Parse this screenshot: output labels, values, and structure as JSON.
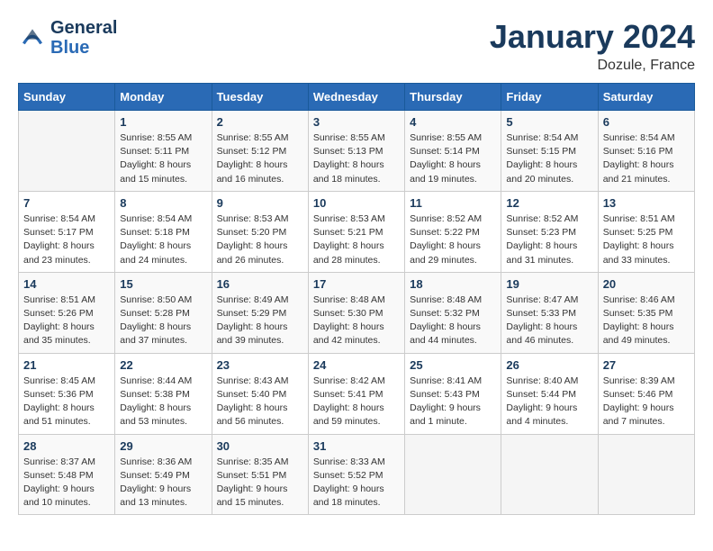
{
  "header": {
    "logo_line1": "General",
    "logo_line2": "Blue",
    "title": "January 2024",
    "subtitle": "Dozule, France"
  },
  "columns": [
    "Sunday",
    "Monday",
    "Tuesday",
    "Wednesday",
    "Thursday",
    "Friday",
    "Saturday"
  ],
  "weeks": [
    {
      "days": [
        {
          "number": "",
          "info": ""
        },
        {
          "number": "1",
          "info": "Sunrise: 8:55 AM\nSunset: 5:11 PM\nDaylight: 8 hours\nand 15 minutes."
        },
        {
          "number": "2",
          "info": "Sunrise: 8:55 AM\nSunset: 5:12 PM\nDaylight: 8 hours\nand 16 minutes."
        },
        {
          "number": "3",
          "info": "Sunrise: 8:55 AM\nSunset: 5:13 PM\nDaylight: 8 hours\nand 18 minutes."
        },
        {
          "number": "4",
          "info": "Sunrise: 8:55 AM\nSunset: 5:14 PM\nDaylight: 8 hours\nand 19 minutes."
        },
        {
          "number": "5",
          "info": "Sunrise: 8:54 AM\nSunset: 5:15 PM\nDaylight: 8 hours\nand 20 minutes."
        },
        {
          "number": "6",
          "info": "Sunrise: 8:54 AM\nSunset: 5:16 PM\nDaylight: 8 hours\nand 21 minutes."
        }
      ]
    },
    {
      "days": [
        {
          "number": "7",
          "info": "Sunrise: 8:54 AM\nSunset: 5:17 PM\nDaylight: 8 hours\nand 23 minutes."
        },
        {
          "number": "8",
          "info": "Sunrise: 8:54 AM\nSunset: 5:18 PM\nDaylight: 8 hours\nand 24 minutes."
        },
        {
          "number": "9",
          "info": "Sunrise: 8:53 AM\nSunset: 5:20 PM\nDaylight: 8 hours\nand 26 minutes."
        },
        {
          "number": "10",
          "info": "Sunrise: 8:53 AM\nSunset: 5:21 PM\nDaylight: 8 hours\nand 28 minutes."
        },
        {
          "number": "11",
          "info": "Sunrise: 8:52 AM\nSunset: 5:22 PM\nDaylight: 8 hours\nand 29 minutes."
        },
        {
          "number": "12",
          "info": "Sunrise: 8:52 AM\nSunset: 5:23 PM\nDaylight: 8 hours\nand 31 minutes."
        },
        {
          "number": "13",
          "info": "Sunrise: 8:51 AM\nSunset: 5:25 PM\nDaylight: 8 hours\nand 33 minutes."
        }
      ]
    },
    {
      "days": [
        {
          "number": "14",
          "info": "Sunrise: 8:51 AM\nSunset: 5:26 PM\nDaylight: 8 hours\nand 35 minutes."
        },
        {
          "number": "15",
          "info": "Sunrise: 8:50 AM\nSunset: 5:28 PM\nDaylight: 8 hours\nand 37 minutes."
        },
        {
          "number": "16",
          "info": "Sunrise: 8:49 AM\nSunset: 5:29 PM\nDaylight: 8 hours\nand 39 minutes."
        },
        {
          "number": "17",
          "info": "Sunrise: 8:48 AM\nSunset: 5:30 PM\nDaylight: 8 hours\nand 42 minutes."
        },
        {
          "number": "18",
          "info": "Sunrise: 8:48 AM\nSunset: 5:32 PM\nDaylight: 8 hours\nand 44 minutes."
        },
        {
          "number": "19",
          "info": "Sunrise: 8:47 AM\nSunset: 5:33 PM\nDaylight: 8 hours\nand 46 minutes."
        },
        {
          "number": "20",
          "info": "Sunrise: 8:46 AM\nSunset: 5:35 PM\nDaylight: 8 hours\nand 49 minutes."
        }
      ]
    },
    {
      "days": [
        {
          "number": "21",
          "info": "Sunrise: 8:45 AM\nSunset: 5:36 PM\nDaylight: 8 hours\nand 51 minutes."
        },
        {
          "number": "22",
          "info": "Sunrise: 8:44 AM\nSunset: 5:38 PM\nDaylight: 8 hours\nand 53 minutes."
        },
        {
          "number": "23",
          "info": "Sunrise: 8:43 AM\nSunset: 5:40 PM\nDaylight: 8 hours\nand 56 minutes."
        },
        {
          "number": "24",
          "info": "Sunrise: 8:42 AM\nSunset: 5:41 PM\nDaylight: 8 hours\nand 59 minutes."
        },
        {
          "number": "25",
          "info": "Sunrise: 8:41 AM\nSunset: 5:43 PM\nDaylight: 9 hours\nand 1 minute."
        },
        {
          "number": "26",
          "info": "Sunrise: 8:40 AM\nSunset: 5:44 PM\nDaylight: 9 hours\nand 4 minutes."
        },
        {
          "number": "27",
          "info": "Sunrise: 8:39 AM\nSunset: 5:46 PM\nDaylight: 9 hours\nand 7 minutes."
        }
      ]
    },
    {
      "days": [
        {
          "number": "28",
          "info": "Sunrise: 8:37 AM\nSunset: 5:48 PM\nDaylight: 9 hours\nand 10 minutes."
        },
        {
          "number": "29",
          "info": "Sunrise: 8:36 AM\nSunset: 5:49 PM\nDaylight: 9 hours\nand 13 minutes."
        },
        {
          "number": "30",
          "info": "Sunrise: 8:35 AM\nSunset: 5:51 PM\nDaylight: 9 hours\nand 15 minutes."
        },
        {
          "number": "31",
          "info": "Sunrise: 8:33 AM\nSunset: 5:52 PM\nDaylight: 9 hours\nand 18 minutes."
        },
        {
          "number": "",
          "info": ""
        },
        {
          "number": "",
          "info": ""
        },
        {
          "number": "",
          "info": ""
        }
      ]
    }
  ]
}
